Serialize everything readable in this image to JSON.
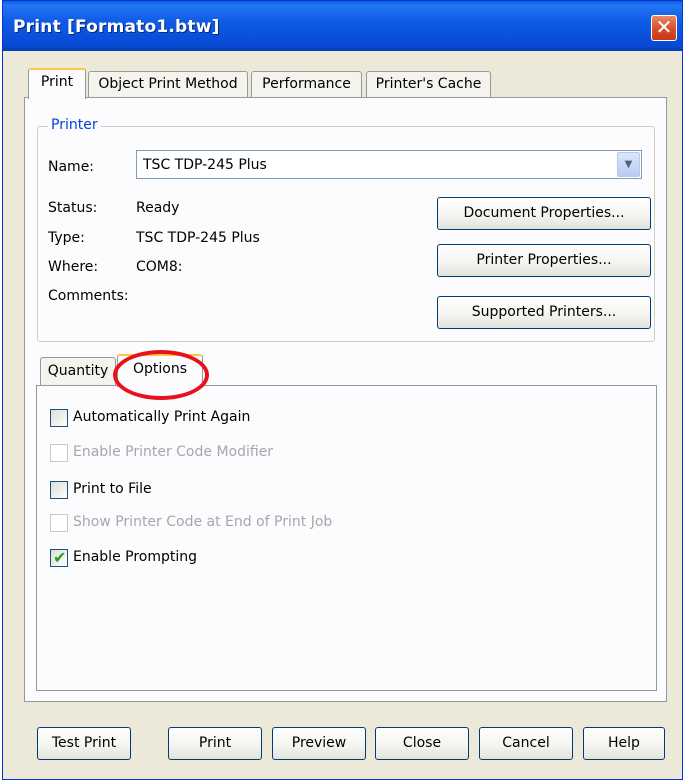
{
  "window": {
    "title": "Print [Formato1.btw]",
    "close_glyph": "✕"
  },
  "tabs": [
    {
      "label": "Print",
      "active": true
    },
    {
      "label": "Object Print Method"
    },
    {
      "label": "Performance"
    },
    {
      "label": "Printer's Cache"
    }
  ],
  "printer": {
    "group_label": "Printer",
    "name_label": "Name:",
    "name_value": "TSC TDP-245 Plus",
    "status_label": "Status:",
    "status_value": "Ready",
    "type_label": "Type:",
    "type_value": "TSC TDP-245 Plus",
    "where_label": "Where:",
    "where_value": "COM8:",
    "comments_label": "Comments:",
    "buttons": {
      "document_properties": "Document Properties...",
      "printer_properties": "Printer Properties...",
      "supported_printers": "Supported Printers..."
    }
  },
  "subtabs": [
    {
      "label": "Quantity"
    },
    {
      "label": "Options",
      "active": true
    }
  ],
  "options": [
    {
      "label": "Automatically Print Again",
      "checked": false,
      "enabled": true
    },
    {
      "label": "Enable Printer Code Modifier",
      "checked": false,
      "enabled": false
    },
    {
      "label": "Print to File",
      "checked": false,
      "enabled": true
    },
    {
      "label": "Show Printer Code at End of Print Job",
      "checked": false,
      "enabled": false
    },
    {
      "label": "Enable Prompting",
      "checked": true,
      "enabled": true
    }
  ],
  "footer_buttons": {
    "test_print": "Test Print",
    "print": "Print",
    "preview": "Preview",
    "close": "Close",
    "cancel": "Cancel",
    "help": "Help"
  },
  "colors": {
    "highlight": "#e8121b",
    "titlebar": "#0f5ce6",
    "group_label": "#0046d5"
  },
  "icons": {
    "dropdown": "chevron-down-icon",
    "close": "close-icon",
    "check": "checkmark-icon"
  }
}
